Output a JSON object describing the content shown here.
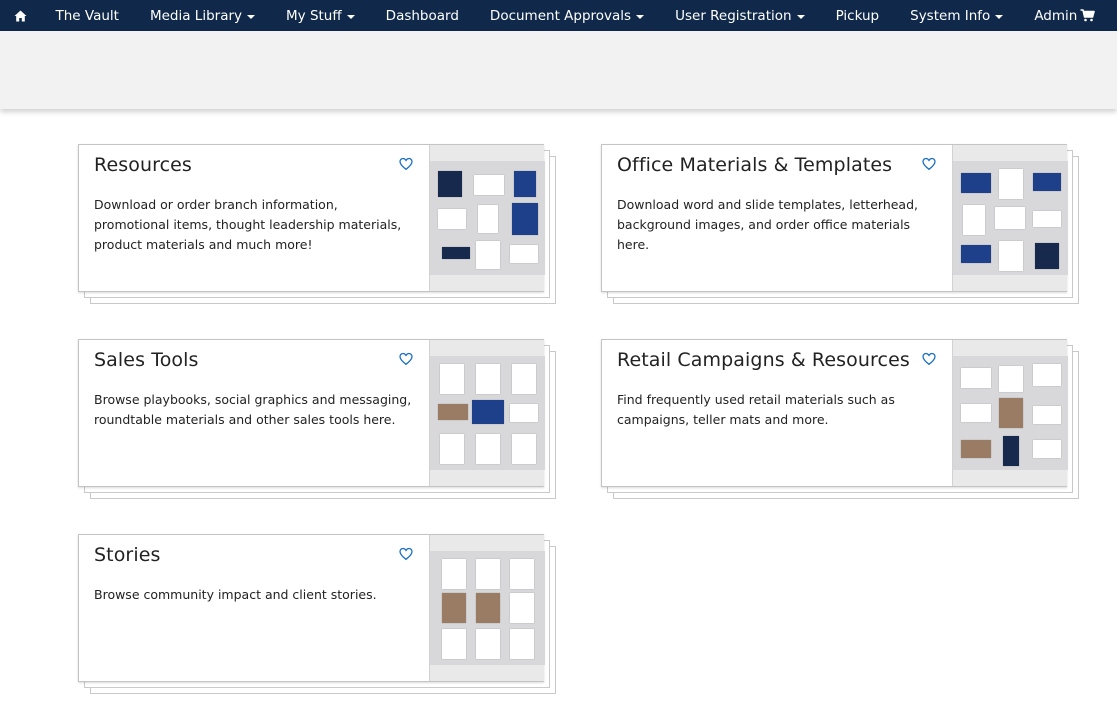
{
  "nav": {
    "home_icon": "home-icon",
    "items": [
      {
        "label": "The Vault",
        "dropdown": false
      },
      {
        "label": "Media Library",
        "dropdown": true
      },
      {
        "label": "My Stuff",
        "dropdown": true
      },
      {
        "label": "Dashboard",
        "dropdown": false
      },
      {
        "label": "Document Approvals",
        "dropdown": true
      },
      {
        "label": "User Registration",
        "dropdown": true
      },
      {
        "label": "Pickup",
        "dropdown": false
      },
      {
        "label": "System Info",
        "dropdown": true
      },
      {
        "label": "Admin",
        "dropdown": false
      }
    ],
    "cart_icon": "shopping-cart-icon"
  },
  "cards": [
    {
      "title": "Resources",
      "description": "Download or order branch information, promotional items, thought leadership materials, product materials and much more!"
    },
    {
      "title": "Office Materials & Templates",
      "description": "Download word and slide templates, letterhead, background images, and order office materials here."
    },
    {
      "title": "Sales Tools",
      "description": "Browse playbooks, social graphics and messaging, roundtable materials and other sales tools here."
    },
    {
      "title": "Retail Campaigns & Resources",
      "description": "Find frequently used retail materials such as campaigns, teller mats and more."
    },
    {
      "title": "Stories",
      "description": "Browse community impact and client stories."
    }
  ],
  "colors": {
    "navbar": "#10294a",
    "accent": "#1a6fc4",
    "banner": "#f2f2f2"
  }
}
